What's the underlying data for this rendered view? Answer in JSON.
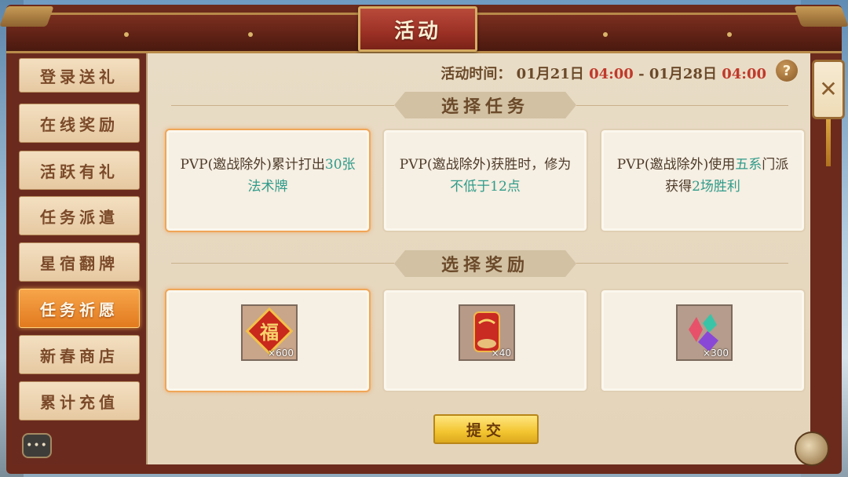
{
  "header": {
    "title": "活动"
  },
  "sidebar": {
    "items": [
      {
        "label": "登录送礼",
        "active": false
      },
      {
        "label": "在线奖励",
        "active": false
      },
      {
        "label": "活跃有礼",
        "active": false
      },
      {
        "label": "任务派遣",
        "active": false
      },
      {
        "label": "星宿翻牌",
        "active": false
      },
      {
        "label": "任务祈愿",
        "active": true
      },
      {
        "label": "新春商店",
        "active": false
      },
      {
        "label": "累计充值",
        "active": false
      }
    ],
    "more_label": "•••"
  },
  "event_time": {
    "label": "活动时间：",
    "start_date": "01月21日",
    "start_time": "04:00",
    "separator": "-",
    "end_date": "01月28日",
    "end_time": "04:00"
  },
  "help": {
    "icon": "question-icon",
    "glyph": "?"
  },
  "tasks": {
    "header": "选择任务",
    "cards": [
      {
        "prefix": "PVP(邀战除外)累计打出",
        "highlight": "30张法术牌",
        "suffix": "",
        "selected": true
      },
      {
        "prefix": "PVP(邀战除外)获胜时，修为",
        "highlight": "不低于12点",
        "suffix": "",
        "selected": false
      },
      {
        "prefix": "PVP(邀战除外)使用",
        "highlight": "五系",
        "suffix": "门派获得",
        "highlight2": "2场胜利",
        "selected": false
      }
    ]
  },
  "rewards": {
    "header": "选择奖励",
    "items": [
      {
        "icon": "fu-charm-icon",
        "quantity": "×600",
        "selected": true
      },
      {
        "icon": "red-pouch-icon",
        "quantity": "×40",
        "selected": false
      },
      {
        "icon": "gems-icon",
        "quantity": "×300",
        "selected": false
      }
    ]
  },
  "submit": {
    "label": "提交"
  },
  "close": {
    "glyph": "✕"
  },
  "colors": {
    "frame": "#6b2a1c",
    "title_plaque": "#9b3025",
    "active_tab": "#e27a1f",
    "highlight_text": "#2f9b8a",
    "time_red": "#c0392b",
    "submit": "#f3c531"
  }
}
